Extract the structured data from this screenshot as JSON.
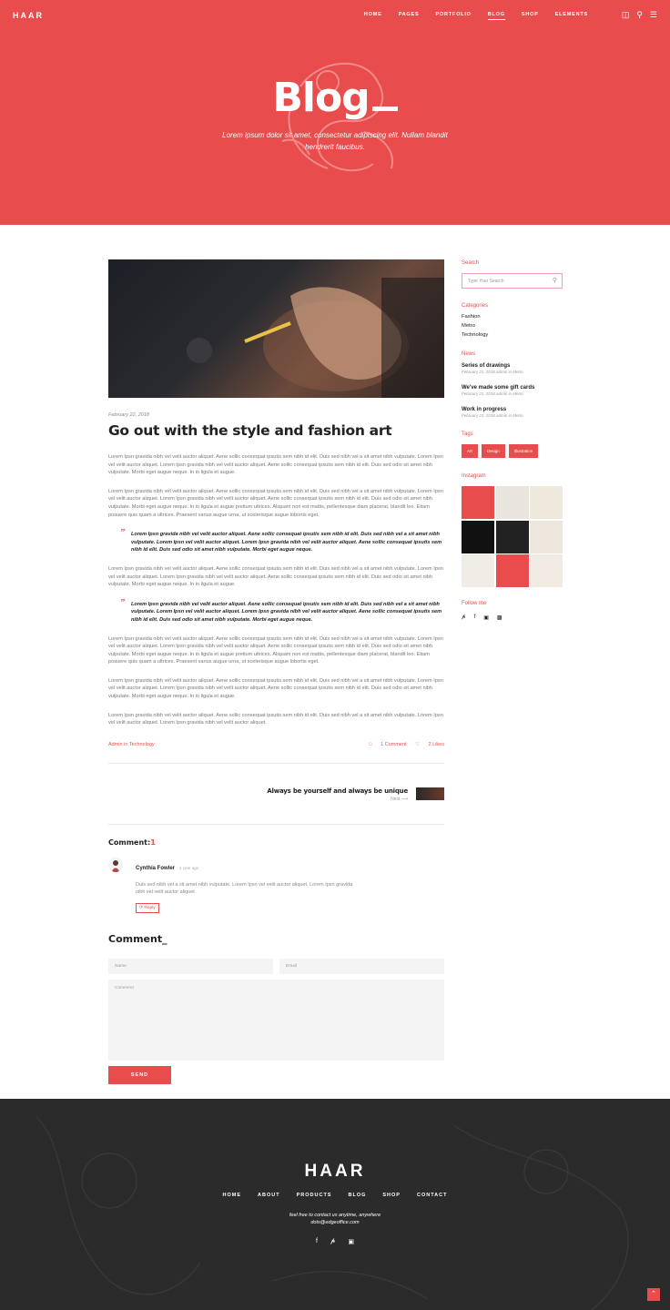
{
  "header": {
    "logo": "HAAR",
    "nav": [
      "HOME",
      "PAGES",
      "PORTFOLIO",
      "BLOG",
      "SHOP",
      "ELEMENTS"
    ],
    "active": "BLOG"
  },
  "hero": {
    "title": "Blog",
    "subtitle": "Lorem ipsum dolor sit amet, consectetur adipiscing elit. Nullam blandit hendrerit faucibus."
  },
  "post": {
    "date": "February 22, 2018",
    "title": "Go out with the style and fashion art",
    "p1": "Lorem Ipsn gravida nibh vel velit auctor aliquet. Aene sollic consequat ipsutis sem nibh id elit. Duis sed nibh vel a sit amet nibh vulputate. Lorem Ipsn vel velit auctor aliquet. Lorem Ipsn gravida nibh vel velit auctor aliquet. Aene sollic consequat ipsutis sem nibh id elit. Duis sed odio sit amet nibh vulputate. Morbi eget augue neque. In in ligula et augue.",
    "p2": "Lorem Ipsn gravida nibh vel velit auctor aliquet. Aene sollic consequat ipsutis sem nibh id elit. Duis sed nibh vel a sit amet nibh vulputate. Lorem Ipsn vel velit auctor aliquet. Lorem Ipsn gravida nibh vel velit auctor aliquet. Aene sollic consequat ipsutis sem nibh id elit. Duis sed odio sit amet nibh vulputate. Morbi eget augue neque. In in ligula et augue pretium ultrices. Aliquam non est mattis, pellentesque diam placerat, blandit leo. Etiam posuere quis quam a ultrices. Praesent varius augue urna, ut scelerisque augue lobortis eget.",
    "q1": "Lorem Ipsn gravida nibh vel velit auctor aliquet. Aene sollic consequat ipsutis sem nibh id elit. Duis sed nibh vel a sit amet nibh vulputate. Lorem Ipsn vel velit auctor aliquet. Lorem Ipsn gravida nibh vel velit auctor aliquet. Aene sollic consequat ipsutis sem nibh id elit. Duis sed odio sit amet nibh vulputate. Morbi eget augue neque.",
    "p3": "Lorem Ipsn gravida nibh vel velit auctor aliquet. Aene sollic consequat ipsutis sem nibh id elit. Duis sed nibh vel a sit amet nibh vulputate. Lorem Ipsn vel velit auctor aliquet. Lorem Ipsn gravida nibh vel velit auctor aliquet. Aene sollic consequat ipsutis sem nibh id elit. Duis sed odio sit amet nibh vulputate. Morbi eget augue neque. In in ligula et augue.",
    "q2": "Lorem Ipsn gravida nibh vel velit auctor aliquet. Aene sollic consequat ipsutis sem nibh id elit. Duis sed nibh vel a sit amet nibh vulputate. Lorem Ipsn vel velit auctor aliquet. Lorem Ipsn gravida nibh vel velit auctor aliquet. Aene sollic consequat ipsutis sem nibh id elit. Duis sed odio sit amet nibh vulputate. Morbi eget augue neque.",
    "p4": "Lorem Ipsn gravida nibh vel velit auctor aliquet. Aene sollic consequat ipsutis sem nibh id elit. Duis sed nibh vel a sit amet nibh vulputate. Lorem Ipsn vel velit auctor aliquet. Lorem Ipsn gravida nibh vel velit auctor aliquet. Aene sollic consequat ipsutis sem nibh id elit. Duis sed odio sit amet nibh vulputate. Morbi eget augue neque. In in ligula et augue pretium ultrices. Aliquam non est mattis, pellentesque diam placerat, blandit leo. Etiam posuere quis quam a ultrices. Praesent varius augue urna, ut scelerisque augue lobortis eget.",
    "p5": "Lorem Ipsn gravida nibh vel velit auctor aliquet. Aene sollic consequat ipsutis sem nibh id elit. Duis sed nibh vel a sit amet nibh vulputate. Lorem Ipsn vel velit auctor aliquet. Lorem Ipsn gravida nibh vel velit auctor aliquet. Aene sollic consequat ipsutis sem nibh id elit. Duis sed odio sit amet nibh vulputate. Morbi eget augue neque. In in ligula et augue.",
    "p6": "Lorem Ipsn gravida nibh vel velit auctor aliquet. Aene sollic consequat ipsutis sem nibh id elit. Duis sed nibh vel a sit amet nibh vulputate. Lorem Ipsn vel velit auctor aliquet. Lorem Ipsn gravida nibh vel velit auctor aliquet.",
    "meta_author": "Admin in Technology",
    "comments": "1 Comment",
    "likes": "2 Likes"
  },
  "next": {
    "title": "Always be yourself and always be unique",
    "label": "Next"
  },
  "comments": {
    "heading": "Comment:",
    "count": "1",
    "name": "Cynthia Fowler",
    "ago": "1 year ago",
    "text": "Duis sed nibh vel a sit amet nibh vulputate. Lorem Ipsn vel velit auctor aliquet. Lorem Ipsn gravida nibh vel velit auctor aliquet",
    "reply": "Reply"
  },
  "form": {
    "heading": "Comment_",
    "name_ph": "Name",
    "email_ph": "Email",
    "comment_ph": "Comment",
    "send": "SEND"
  },
  "sidebar": {
    "search_h": "Search",
    "search_ph": "Type Your Search",
    "categories_h": "Categories",
    "categories": [
      "Fashion",
      "Metro",
      "Technology"
    ],
    "news_h": "News",
    "news": [
      {
        "title": "Series of drawings",
        "meta": "February 21, 2018 admin in Metro"
      },
      {
        "title": "We've made some gift cards",
        "meta": "February 21, 2018 admin in Metro"
      },
      {
        "title": "Work in progress",
        "meta": "February 21, 2018 admin in Metro"
      }
    ],
    "tags_h": "Tags",
    "tags": [
      "Art",
      "Design",
      "Illustration"
    ],
    "instagram_h": "Instagram",
    "follow_h": "Follow me"
  },
  "footer": {
    "logo": "HAAR",
    "nav": [
      "HOME",
      "ABOUT",
      "PRODUCTS",
      "BLOG",
      "SHOP",
      "CONTACT"
    ],
    "text1": "feel free to contact us anytime, anywhere",
    "text2": "dots@edgeoffice.com"
  },
  "colors": {
    "accent": "#e84c4c",
    "footer_bg": "#2b2b2b"
  }
}
